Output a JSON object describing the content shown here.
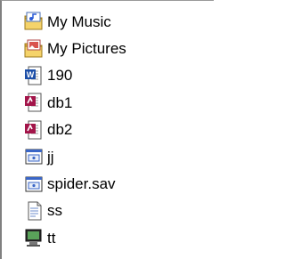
{
  "items": [
    {
      "label": "My Music",
      "icon": "music-folder-icon"
    },
    {
      "label": "My Pictures",
      "icon": "pictures-folder-icon"
    },
    {
      "label": "190",
      "icon": "word-document-icon"
    },
    {
      "label": "db1",
      "icon": "access-database-icon"
    },
    {
      "label": "db2",
      "icon": "access-database-icon"
    },
    {
      "label": "jj",
      "icon": "application-file-icon"
    },
    {
      "label": "spider.sav",
      "icon": "application-file-icon"
    },
    {
      "label": "ss",
      "icon": "text-file-icon"
    },
    {
      "label": "tt",
      "icon": "program-file-icon"
    }
  ],
  "colors": {
    "folder": "#f2c94c",
    "word_blue": "#1d4fa8",
    "access_red": "#a3154a",
    "app_blue": "#3a66c7"
  }
}
